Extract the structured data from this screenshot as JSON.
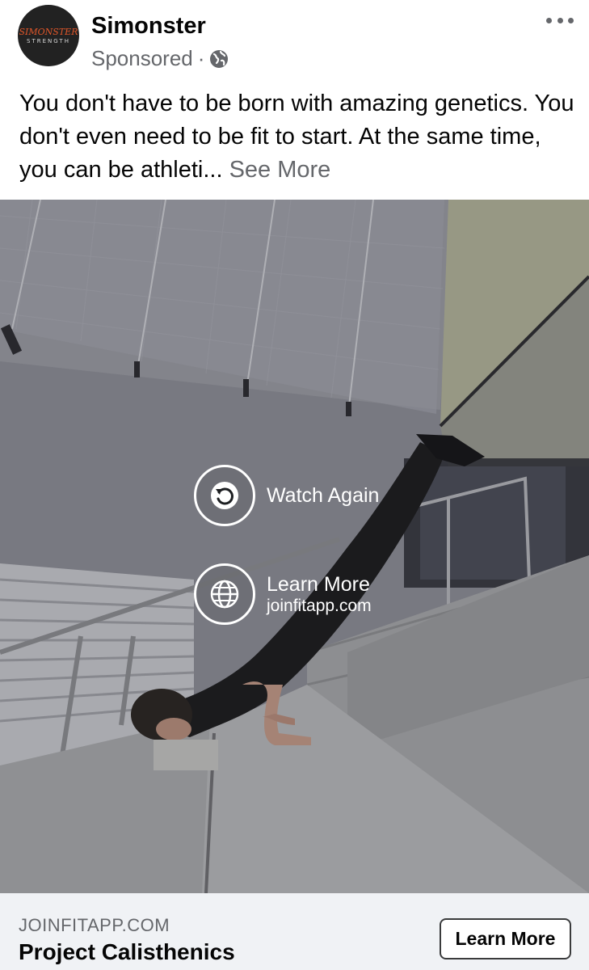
{
  "post": {
    "page_name": "Simonster",
    "avatar_logo": {
      "line1": "SIMONSTER",
      "line2": "STRENGTH"
    },
    "sponsored_label": "Sponsored",
    "separator": "·",
    "privacy_icon": "globe-icon",
    "menu_icon": "more-horizontal-icon",
    "text": "You don't have to be born with amazing genetics. You don't even need to be fit to start. At the same time, you can be athleti...",
    "see_more": "See More"
  },
  "video_overlay": {
    "watch_again_label": "Watch Again",
    "watch_again_icon": "replay-icon",
    "learn_more_label": "Learn More",
    "learn_more_domain": "joinfitapp.com",
    "learn_more_icon": "globe-icon"
  },
  "ad_footer": {
    "domain": "JOINFITAPP.COM",
    "title": "Project Calisthenics",
    "cta_label": "Learn More"
  },
  "colors": {
    "text_primary": "#050505",
    "text_secondary": "#65676b",
    "footer_bg": "#f0f2f5",
    "logo_accent": "#e2572a"
  }
}
